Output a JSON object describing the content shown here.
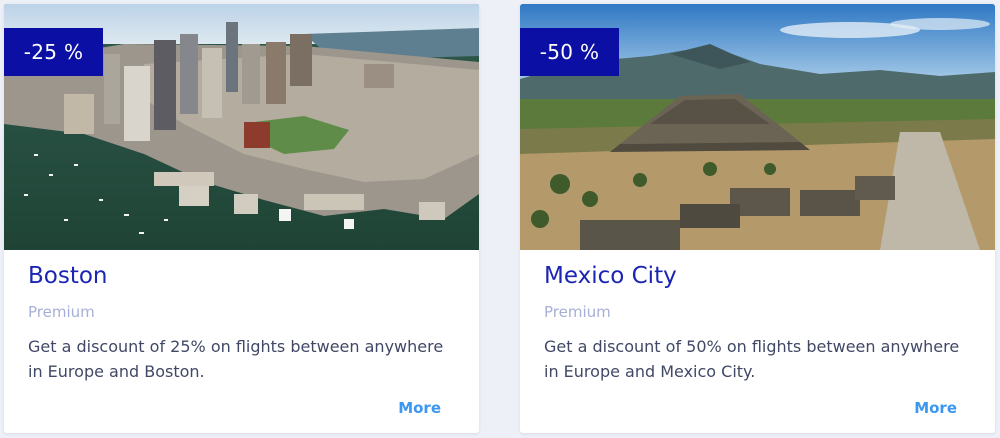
{
  "cards": [
    {
      "badge": "-25 %",
      "title": "Boston",
      "tier": "Premium",
      "description": "Get a discount of 25% on flights between anywhere in Europe and Boston.",
      "more_label": "More"
    },
    {
      "badge": "-50 %",
      "title": "Mexico City",
      "tier": "Premium",
      "description": "Get a discount of 50% on flights between anywhere in Europe and Mexico City.",
      "more_label": "More"
    }
  ],
  "colors": {
    "page_background": "#eef0f7",
    "badge_background": "#0b0fa3",
    "title": "#1b25b3",
    "tier": "#a6b0d6",
    "description": "#414866",
    "link": "#3b97f0"
  }
}
